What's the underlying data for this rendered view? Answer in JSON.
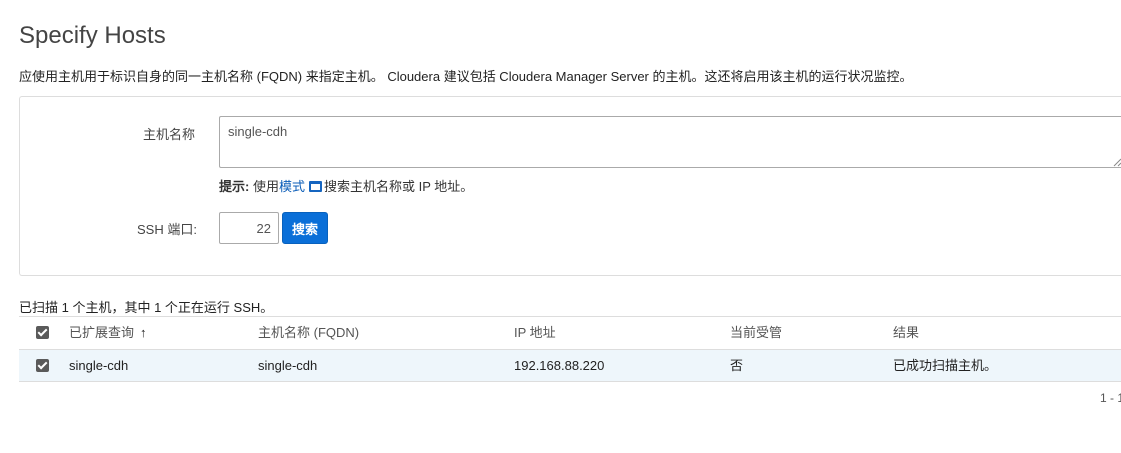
{
  "page": {
    "title": "Specify Hosts",
    "description": "应使用主机用于标识自身的同一主机名称 (FQDN) 来指定主机。 Cloudera 建议包括 Cloudera Manager Server 的主机。这还将启用该主机的运行状况监控。"
  },
  "form": {
    "hostname_label": "主机名称",
    "hostname_value": "single-cdh",
    "hint_prefix": "提示:",
    "hint_use": " 使用",
    "hint_link": "模式",
    "hint_icon": "pattern-help-icon",
    "hint_suffix": "搜索主机名称或 IP 地址。",
    "ssh_label": "SSH 端口:",
    "ssh_port": "22",
    "search_button": "搜索"
  },
  "results": {
    "summary": "已扫描 1 个主机，其中 1 个正在运行 SSH。",
    "columns": {
      "expanded_query": "已扩展查询",
      "sort_indicator": "↑",
      "fqdn": "主机名称 (FQDN)",
      "ip": "IP 地址",
      "managed": "当前受管",
      "result": "结果"
    },
    "rows": [
      {
        "checked": true,
        "expanded_query": "single-cdh",
        "fqdn": "single-cdh",
        "ip": "192.168.88.220",
        "managed": "否",
        "result": "已成功扫描主机。"
      }
    ],
    "pager": "1 - 1"
  },
  "colors": {
    "primary_button": "#0a6fd8",
    "link": "#0b5db8",
    "selected_row": "#eef6fb",
    "checkbox": "#5a5a5a"
  }
}
